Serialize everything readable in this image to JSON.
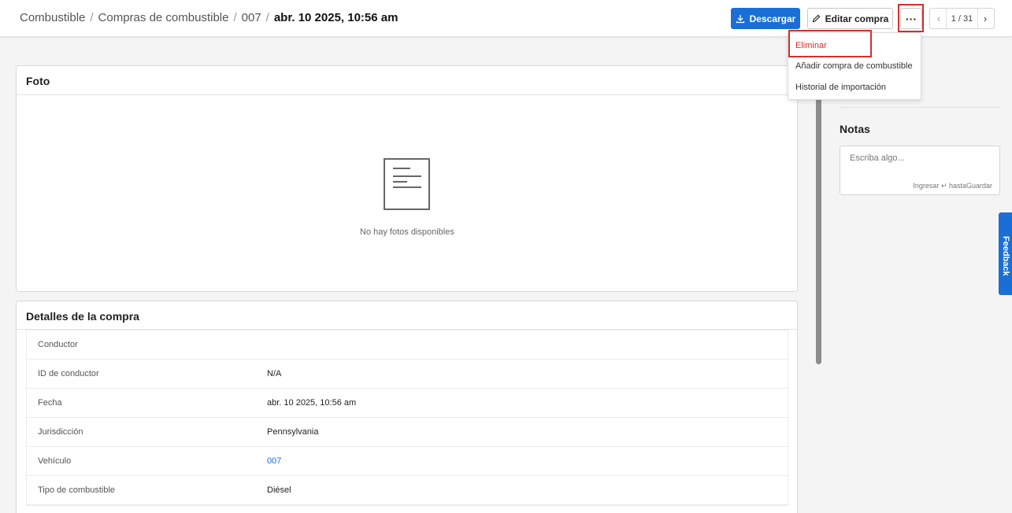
{
  "breadcrumb": {
    "items": [
      "Combustible",
      "Compras de combustible",
      "007"
    ],
    "current": "abr. 10 2025, 10:56 am",
    "separator": "/"
  },
  "toolbar": {
    "download_label": "Descargar",
    "edit_label": "Editar compra",
    "more_label": "···"
  },
  "pager": {
    "count": "1 / 31",
    "prev": "‹",
    "next": "›"
  },
  "menu": {
    "items": [
      "Eliminar",
      "Añadir compra de combustible",
      "Historial de importación"
    ]
  },
  "photo": {
    "title": "Foto",
    "empty_text": "No hay fotos disponibles"
  },
  "details": {
    "title": "Detalles de la compra",
    "rows": [
      {
        "label": "Conductor",
        "value": ""
      },
      {
        "label": "ID de conductor",
        "value": "N/A"
      },
      {
        "label": "Fecha",
        "value": "abr. 10 2025, 10:56 am"
      },
      {
        "label": "Jurisdicción",
        "value": "Pennsylvania"
      },
      {
        "label": "Vehículo",
        "value": "007"
      },
      {
        "label": "Tipo de combustible",
        "value": "Diésel"
      }
    ]
  },
  "notes": {
    "title": "Notas",
    "placeholder": "Escriba algo...",
    "hint": "Ingresar ↵ hastaGuardar"
  },
  "feedback": {
    "label": "Feedback"
  },
  "colors": {
    "primary": "#1a6fd6",
    "danger": "#d32f2f",
    "highlight": "#d32f2f"
  }
}
